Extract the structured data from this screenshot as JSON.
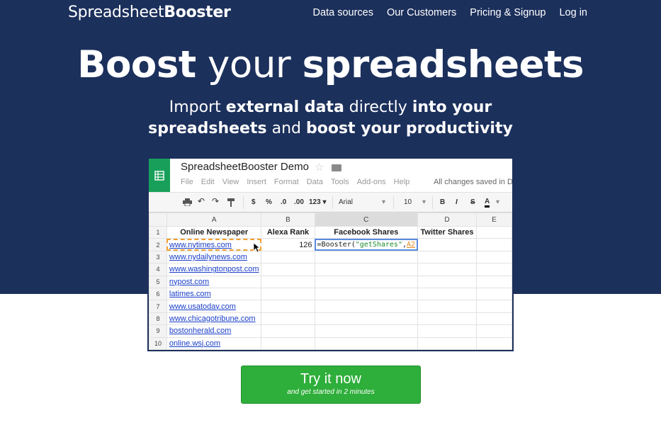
{
  "brand": {
    "name_light": "Spreadsheet",
    "name_bold": "Booster"
  },
  "nav": [
    "Data sources",
    "Our Customers",
    "Pricing & Signup",
    "Log in"
  ],
  "headline": {
    "part1": "Boost",
    "part2": " your ",
    "part3": "spreadsheets"
  },
  "subheadline": {
    "a": "Import ",
    "b": "external data",
    "c": " directly ",
    "d": "into your",
    "e": "spreadsheets",
    "f": " and ",
    "g": "boost your productivity"
  },
  "sheet": {
    "title": "SpreadsheetBooster Demo",
    "menu": [
      "File",
      "Edit",
      "View",
      "Insert",
      "Format",
      "Data",
      "Tools",
      "Add-ons",
      "Help"
    ],
    "status": "All changes saved in D",
    "toolbar": {
      "currency": "$",
      "percent": "%",
      "dec_less": ".0",
      "dec_more": ".00",
      "format": "123 ▾",
      "font": "Arial",
      "size": "10",
      "bold": "B",
      "italic": "I",
      "strike": "S",
      "color": "A"
    },
    "columns": [
      "A",
      "B",
      "C",
      "D",
      "E"
    ],
    "rows": [
      {
        "n": "1",
        "a": "Online Newspaper",
        "b": "Alexa Rank",
        "c": "Facebook Shares",
        "d": "Twitter Shares"
      },
      {
        "n": "2",
        "a": "www.nytimes.com",
        "b": "126",
        "c": "",
        "d": ""
      },
      {
        "n": "3",
        "a": "www.nydailynews.com",
        "b": "",
        "c": "",
        "d": ""
      },
      {
        "n": "4",
        "a": "www.washingtonpost.com",
        "b": "",
        "c": "",
        "d": ""
      },
      {
        "n": "5",
        "a": "nypost.com",
        "b": "",
        "c": "",
        "d": ""
      },
      {
        "n": "6",
        "a": "latimes.com",
        "b": "",
        "c": "",
        "d": ""
      },
      {
        "n": "7",
        "a": "www.usatoday.com",
        "b": "",
        "c": "",
        "d": ""
      },
      {
        "n": "8",
        "a": "www.chicagotribune.com",
        "b": "",
        "c": "",
        "d": ""
      },
      {
        "n": "9",
        "a": "bostonherald.com",
        "b": "",
        "c": "",
        "d": ""
      },
      {
        "n": "10",
        "a": "online.wsj.com",
        "b": "",
        "c": "",
        "d": ""
      }
    ],
    "formula": {
      "prefix": "=Booster(",
      "arg": "\"getShares\"",
      "sep": ",",
      "ref": "A2"
    }
  },
  "cta": {
    "label": "Try it now",
    "sub": "and get started in 2 minutes"
  },
  "colors": {
    "hero_bg": "#1c305c",
    "cta_bg": "#2eae3a",
    "sheets_green": "#18a05a"
  }
}
